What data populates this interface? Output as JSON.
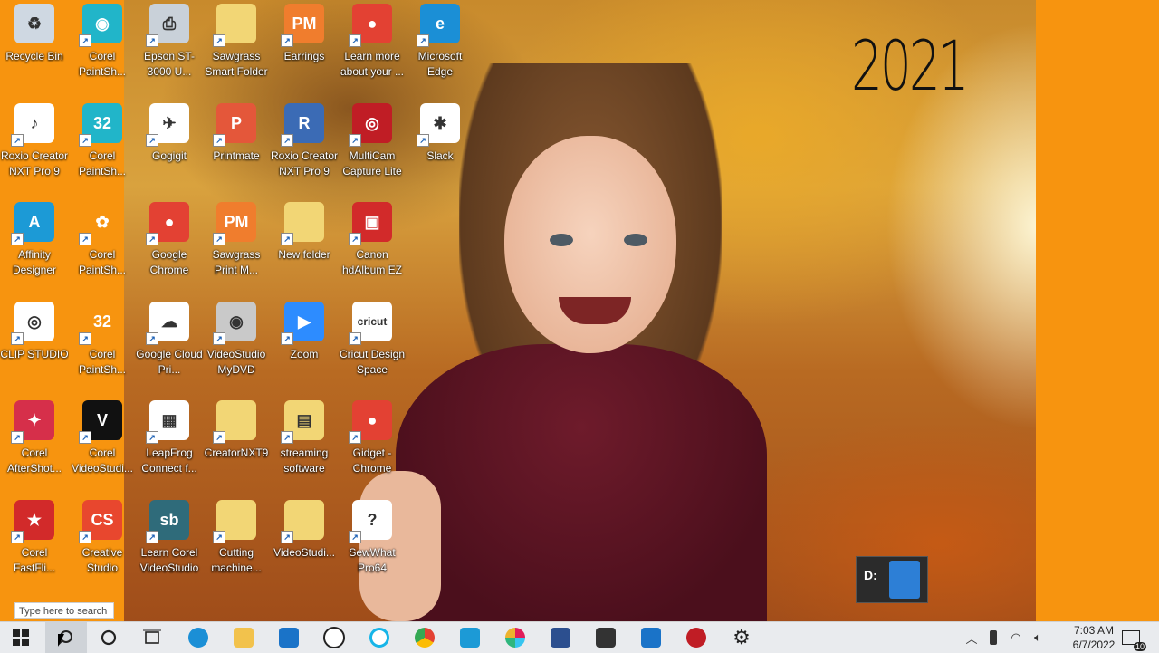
{
  "wallpaper": {
    "year_text": "2021"
  },
  "desktop_icons": [
    {
      "id": "recycle-bin",
      "label": "Recycle Bin",
      "color": "#cfd8e2",
      "glyph": "♻"
    },
    {
      "id": "corel-paintshop-1",
      "label": "Corel PaintSh...",
      "color": "#21b5c9",
      "glyph": "◉"
    },
    {
      "id": "epson",
      "label": "Epson ST-3000 U...",
      "color": "#c9d1d9",
      "glyph": "⎙"
    },
    {
      "id": "sawgrass-smart-folder",
      "label": "Sawgrass Smart Folder",
      "color": "#f2d675",
      "glyph": ""
    },
    {
      "id": "earrings",
      "label": "Earrings",
      "color": "#f07d2d",
      "glyph": "PM"
    },
    {
      "id": "learn-more",
      "label": "Learn more about your ...",
      "color": "#e34133",
      "glyph": "●"
    },
    {
      "id": "microsoft-edge",
      "label": "Microsoft Edge",
      "color": "#1b8fd6",
      "glyph": "e"
    },
    {
      "id": "roxio-creator-1",
      "label": "Roxio Creator NXT Pro 9",
      "color": "#ffffff",
      "glyph": "♪"
    },
    {
      "id": "corel-paintshop-2",
      "label": "Corel PaintSh...",
      "color": "#21b5c9",
      "glyph": "32"
    },
    {
      "id": "gogigit",
      "label": "Gogigit",
      "color": "#ffffff",
      "glyph": "✈"
    },
    {
      "id": "printmate",
      "label": "Printmate",
      "color": "#e4573a",
      "glyph": "P"
    },
    {
      "id": "roxio-creator-2",
      "label": "Roxio Creator NXT Pro 9",
      "color": "#3b6bb5",
      "glyph": "R"
    },
    {
      "id": "multicam",
      "label": "MultiCam Capture Lite",
      "color": "#c01d25",
      "glyph": "◎"
    },
    {
      "id": "slack",
      "label": "Slack",
      "color": "#ffffff",
      "glyph": "✱"
    },
    {
      "id": "affinity-designer",
      "label": "Affinity Designer",
      "color": "#1c9ad6",
      "glyph": "A"
    },
    {
      "id": "corel-paintshop-3",
      "label": "Corel PaintSh...",
      "color": "#f7940f",
      "glyph": "✿"
    },
    {
      "id": "google-chrome",
      "label": "Google Chrome",
      "color": "#e34133",
      "glyph": "●"
    },
    {
      "id": "sawgrass-print",
      "label": "Sawgrass Print M...",
      "color": "#f07d2d",
      "glyph": "PM"
    },
    {
      "id": "new-folder",
      "label": "New folder",
      "color": "#f2d675",
      "glyph": ""
    },
    {
      "id": "canon-hdalbum",
      "label": "Canon hdAlbum EZ",
      "color": "#d22a2a",
      "glyph": "▣"
    },
    {
      "id": "clip-studio",
      "label": "CLIP STUDIO",
      "color": "#ffffff",
      "glyph": "◎"
    },
    {
      "id": "corel-paintshop-4",
      "label": "Corel PaintSh...",
      "color": "#f7940f",
      "glyph": "32"
    },
    {
      "id": "google-cloud-print",
      "label": "Google Cloud Pri...",
      "color": "#ffffff",
      "glyph": "☁"
    },
    {
      "id": "videostudio-mydvd",
      "label": "VideoStudio MyDVD",
      "color": "#c9c9c9",
      "glyph": "◉"
    },
    {
      "id": "zoom",
      "label": "Zoom",
      "color": "#2d8cff",
      "glyph": "▶"
    },
    {
      "id": "cricut",
      "label": "Cricut Design Space",
      "color": "#ffffff",
      "glyph": "cricut"
    },
    {
      "id": "corel-aftershot",
      "label": "Corel AfterShot...",
      "color": "#d62f4a",
      "glyph": "✦"
    },
    {
      "id": "corel-videostudio",
      "label": "Corel VideoStudi...",
      "color": "#111111",
      "glyph": "V"
    },
    {
      "id": "leapfrog",
      "label": "LeapFrog Connect f...",
      "color": "#ffffff",
      "glyph": "▦"
    },
    {
      "id": "creatornxt9",
      "label": "CreatorNXT9",
      "color": "#f2d675",
      "glyph": ""
    },
    {
      "id": "streaming-software",
      "label": "streaming software",
      "color": "#f2d675",
      "glyph": "▤"
    },
    {
      "id": "gidget-chrome",
      "label": "Gidget - Chrome",
      "color": "#e34133",
      "glyph": "●"
    },
    {
      "id": "corel-fastflick",
      "label": "Corel FastFli...",
      "color": "#d22a2a",
      "glyph": "★"
    },
    {
      "id": "creative-studio",
      "label": "Creative Studio",
      "color": "#e8472e",
      "glyph": "CS"
    },
    {
      "id": "learn-corel-videostudio",
      "label": "Learn Corel VideoStudio",
      "color": "#2f6b7a",
      "glyph": "sb"
    },
    {
      "id": "cutting-machine",
      "label": "Cutting machine...",
      "color": "#f2d675",
      "glyph": ""
    },
    {
      "id": "videostudio-folder",
      "label": "VideoStudi...",
      "color": "#f2d675",
      "glyph": ""
    },
    {
      "id": "sewwhat",
      "label": "SewWhat Pro64",
      "color": "#ffffff",
      "glyph": "?"
    }
  ],
  "drive_popup": {
    "label": "D:"
  },
  "search": {
    "placeholder": "Type here to search"
  },
  "taskbar": {
    "apps": [
      "start",
      "search",
      "cortana",
      "task-view",
      "edge",
      "file-explorer",
      "mail",
      "dell",
      "alexa",
      "chrome",
      "affinity",
      "slack",
      "roxio",
      "clapper",
      "videostudio",
      "multicam",
      "settings"
    ],
    "clock_time": "7:03 AM",
    "clock_date": "6/7/2022",
    "notification_count": "10"
  }
}
